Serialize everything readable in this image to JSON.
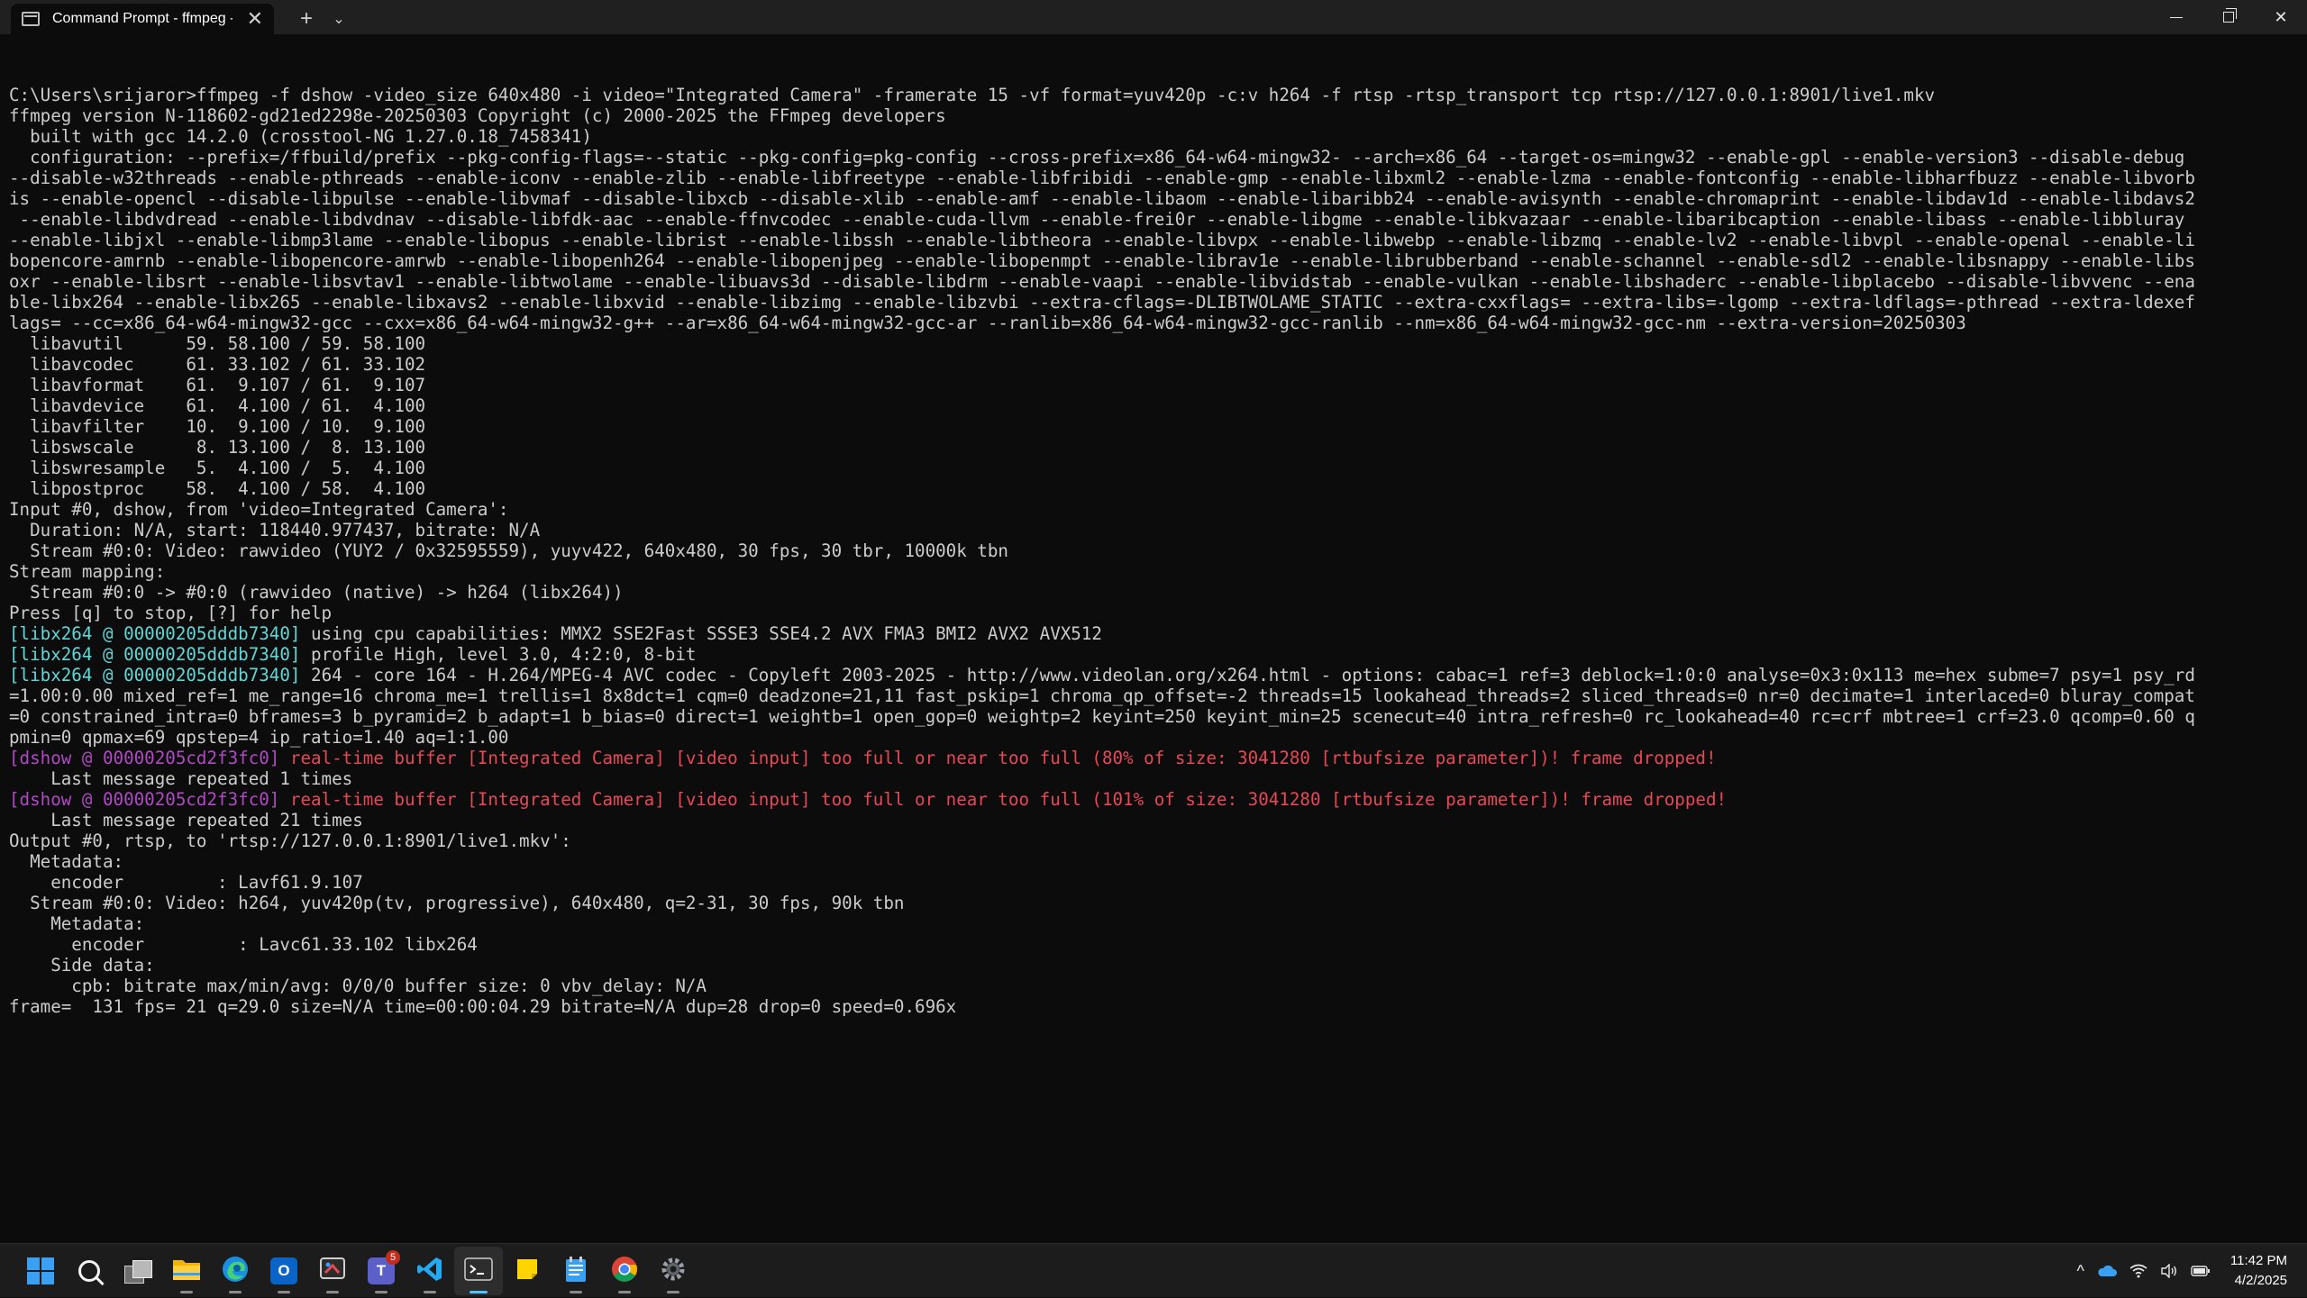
{
  "window": {
    "tab_title": "Command Prompt - ffmpeg -",
    "close_glyph": "✕",
    "new_tab_glyph": "+",
    "dropdown_glyph": "⌄",
    "close_window_glyph": "✕"
  },
  "console": {
    "lines": [
      "",
      [
        {
          "t": "C:\\Users\\srijaror>ffmpeg -f dshow -video_size 640x480 -i video=\"Integrated Camera\" -framerate 15 -vf format=yuv420p -c:v h264 -f rtsp -rtsp_transport tcp rtsp://127.0.0.1:8901/live1.mkv"
        }
      ],
      [
        {
          "t": "ffmpeg version N-118602-gd21ed2298e-20250303 Copyright (c) 2000-2025 the FFmpeg developers"
        }
      ],
      [
        {
          "t": "  built with gcc 14.2.0 (crosstool-NG 1.27.0.18_7458341)"
        }
      ],
      [
        {
          "t": "  configuration: --prefix=/ffbuild/prefix --pkg-config-flags=--static --pkg-config=pkg-config --cross-prefix=x86_64-w64-mingw32- --arch=x86_64 --target-os=mingw32 --enable-gpl --enable-version3 --disable-debug"
        }
      ],
      [
        {
          "t": "--disable-w32threads --enable-pthreads --enable-iconv --enable-zlib --enable-libfreetype --enable-libfribidi --enable-gmp --enable-libxml2 --enable-lzma --enable-fontconfig --enable-libharfbuzz --enable-libvorb"
        }
      ],
      [
        {
          "t": "is --enable-opencl --disable-libpulse --enable-libvmaf --disable-libxcb --disable-xlib --enable-amf --enable-libaom --enable-libaribb24 --enable-avisynth --enable-chromaprint --enable-libdav1d --enable-libdavs2"
        }
      ],
      [
        {
          "t": " --enable-libdvdread --enable-libdvdnav --disable-libfdk-aac --enable-ffnvcodec --enable-cuda-llvm --enable-frei0r --enable-libgme --enable-libkvazaar --enable-libaribcaption --enable-libass --enable-libbluray"
        }
      ],
      [
        {
          "t": "--enable-libjxl --enable-libmp3lame --enable-libopus --enable-librist --enable-libssh --enable-libtheora --enable-libvpx --enable-libwebp --enable-libzmq --enable-lv2 --enable-libvpl --enable-openal --enable-li"
        }
      ],
      [
        {
          "t": "bopencore-amrnb --enable-libopencore-amrwb --enable-libopenh264 --enable-libopenjpeg --enable-libopenmpt --enable-librav1e --enable-librubberband --enable-schannel --enable-sdl2 --enable-libsnappy --enable-libs"
        }
      ],
      [
        {
          "t": "oxr --enable-libsrt --enable-libsvtav1 --enable-libtwolame --enable-libuavs3d --disable-libdrm --enable-vaapi --enable-libvidstab --enable-vulkan --enable-libshaderc --enable-libplacebo --disable-libvvenc --ena"
        }
      ],
      [
        {
          "t": "ble-libx264 --enable-libx265 --enable-libxavs2 --enable-libxvid --enable-libzimg --enable-libzvbi --extra-cflags=-DLIBTWOLAME_STATIC --extra-cxxflags= --extra-libs=-lgomp --extra-ldflags=-pthread --extra-ldexef"
        }
      ],
      [
        {
          "t": "lags= --cc=x86_64-w64-mingw32-gcc --cxx=x86_64-w64-mingw32-g++ --ar=x86_64-w64-mingw32-gcc-ar --ranlib=x86_64-w64-mingw32-gcc-ranlib --nm=x86_64-w64-mingw32-gcc-nm --extra-version=20250303"
        }
      ],
      [
        {
          "t": "  libavutil      59. 58.100 / 59. 58.100"
        }
      ],
      [
        {
          "t": "  libavcodec     61. 33.102 / 61. 33.102"
        }
      ],
      [
        {
          "t": "  libavformat    61.  9.107 / 61.  9.107"
        }
      ],
      [
        {
          "t": "  libavdevice    61.  4.100 / 61.  4.100"
        }
      ],
      [
        {
          "t": "  libavfilter    10.  9.100 / 10.  9.100"
        }
      ],
      [
        {
          "t": "  libswscale      8. 13.100 /  8. 13.100"
        }
      ],
      [
        {
          "t": "  libswresample   5.  4.100 /  5.  4.100"
        }
      ],
      [
        {
          "t": "  libpostproc    58.  4.100 / 58.  4.100"
        }
      ],
      [
        {
          "t": "Input #0, dshow, from 'video=Integrated Camera':"
        }
      ],
      [
        {
          "t": "  Duration: N/A, start: 118440.977437, bitrate: N/A"
        }
      ],
      [
        {
          "t": "  Stream #0:0: Video: rawvideo (YUY2 / 0x32595559), yuyv422, 640x480, 30 fps, 30 tbr, 10000k tbn"
        }
      ],
      [
        {
          "t": "Stream mapping:"
        }
      ],
      [
        {
          "t": "  Stream #0:0 -> #0:0 (rawvideo (native) -> h264 (libx264))"
        }
      ],
      [
        {
          "t": "Press [q] to stop, [?] for help"
        }
      ],
      [
        {
          "t": "[libx264 @ 00000205dddb7340] ",
          "c": "ansi-cyan2"
        },
        {
          "t": "using cpu capabilities: MMX2 SSE2Fast SSSE3 SSE4.2 AVX FMA3 BMI2 AVX2 AVX512"
        }
      ],
      [
        {
          "t": "[libx264 @ 00000205dddb7340] ",
          "c": "ansi-cyan2"
        },
        {
          "t": "profile High, level 3.0, 4:2:0, 8-bit"
        }
      ],
      [
        {
          "t": "[libx264 @ 00000205dddb7340] ",
          "c": "ansi-cyan2"
        },
        {
          "t": "264 - core 164 - H.264/MPEG-4 AVC codec - Copyleft 2003-2025 - http://www.videolan.org/x264.html - options: cabac=1 ref=3 deblock=1:0:0 analyse=0x3:0x113 me=hex subme=7 psy=1 psy_rd"
        }
      ],
      [
        {
          "t": "=1.00:0.00 mixed_ref=1 me_range=16 chroma_me=1 trellis=1 8x8dct=1 cqm=0 deadzone=21,11 fast_pskip=1 chroma_qp_offset=-2 threads=15 lookahead_threads=2 sliced_threads=0 nr=0 decimate=1 interlaced=0 bluray_compat"
        }
      ],
      [
        {
          "t": "=0 constrained_intra=0 bframes=3 b_pyramid=2 b_adapt=1 b_bias=0 direct=1 weightb=1 open_gop=0 weightp=2 keyint=250 keyint_min=25 scenecut=40 intra_refresh=0 rc_lookahead=40 rc=crf mbtree=1 crf=23.0 qcomp=0.60 q"
        }
      ],
      [
        {
          "t": "pmin=0 qpmax=69 qpstep=4 ip_ratio=1.40 aq=1:1.00"
        }
      ],
      [
        {
          "t": "[dshow @ 00000205cd2f3fc0] ",
          "c": "ansi-magenta"
        },
        {
          "t": "real-time buffer [Integrated Camera] [video input] too full or near too full (80% of size: 3041280 [rtbufsize parameter])! frame dropped!",
          "c": "ansi-red"
        }
      ],
      [
        {
          "t": "    Last message repeated 1 times"
        }
      ],
      [
        {
          "t": "[dshow @ 00000205cd2f3fc0] ",
          "c": "ansi-magenta"
        },
        {
          "t": "real-time buffer [Integrated Camera] [video input] too full or near too full (101% of size: 3041280 [rtbufsize parameter])! frame dropped!",
          "c": "ansi-red"
        }
      ],
      [
        {
          "t": "    Last message repeated 21 times"
        }
      ],
      [
        {
          "t": "Output #0, rtsp, to 'rtsp://127.0.0.1:8901/live1.mkv':"
        }
      ],
      [
        {
          "t": "  Metadata:"
        }
      ],
      [
        {
          "t": "    encoder         : Lavf61.9.107"
        }
      ],
      [
        {
          "t": "  Stream #0:0: Video: h264, yuv420p(tv, progressive), 640x480, q=2-31, 30 fps, 90k tbn"
        }
      ],
      [
        {
          "t": "    Metadata:"
        }
      ],
      [
        {
          "t": "      encoder         : Lavc61.33.102 libx264"
        }
      ],
      [
        {
          "t": "    Side data:"
        }
      ],
      [
        {
          "t": "      cpb: bitrate max/min/avg: 0/0/0 buffer size: 0 vbv_delay: N/A"
        }
      ],
      [
        {
          "t": "frame=  131 fps= 21 q=29.0 size=N/A time=00:00:04.29 bitrate=N/A dup=28 drop=0 speed=0.696x"
        }
      ]
    ]
  },
  "taskbar": {
    "apps": [
      {
        "name": "start-button",
        "icon": "windows-logo-icon"
      },
      {
        "name": "search-button",
        "icon": "search-icon"
      },
      {
        "name": "task-view-button",
        "icon": "task-view-icon"
      },
      {
        "name": "file-explorer-button",
        "icon": "folder-icon",
        "running": true
      },
      {
        "name": "edge-button",
        "icon": "edge-icon",
        "running": true
      },
      {
        "name": "outlook-button",
        "icon": "outlook-icon",
        "running": true,
        "letter": "O",
        "color": "#0a64c8"
      },
      {
        "name": "snipping-tool-button",
        "icon": "snipping-tool-icon",
        "running": true
      },
      {
        "name": "teams-button",
        "icon": "teams-icon",
        "running": true,
        "letter": "T",
        "color": "#5b5fc7",
        "badge": "5"
      },
      {
        "name": "vscode-button",
        "icon": "vscode-icon",
        "running": true
      },
      {
        "name": "terminal-button",
        "icon": "terminal-icon",
        "running": true,
        "active": true
      },
      {
        "name": "sticky-notes-button",
        "icon": "sticky-notes-icon"
      },
      {
        "name": "notepad-button",
        "icon": "notepad-icon",
        "running": true
      },
      {
        "name": "chrome-button",
        "icon": "chrome-icon",
        "running": true
      },
      {
        "name": "settings-button",
        "icon": "gear-icon",
        "running": true
      }
    ],
    "tray": {
      "chevron": "^",
      "time": "11:42 PM",
      "date": "4/2/2025"
    }
  },
  "colors": {
    "console_bg": "#0c0c0c",
    "console_fg": "#cccccc",
    "log_tag_libx264": "#61d6d6",
    "log_tag_dshow": "#b148c6",
    "warning_red": "#e74856",
    "accent": "#4cc2ff"
  }
}
